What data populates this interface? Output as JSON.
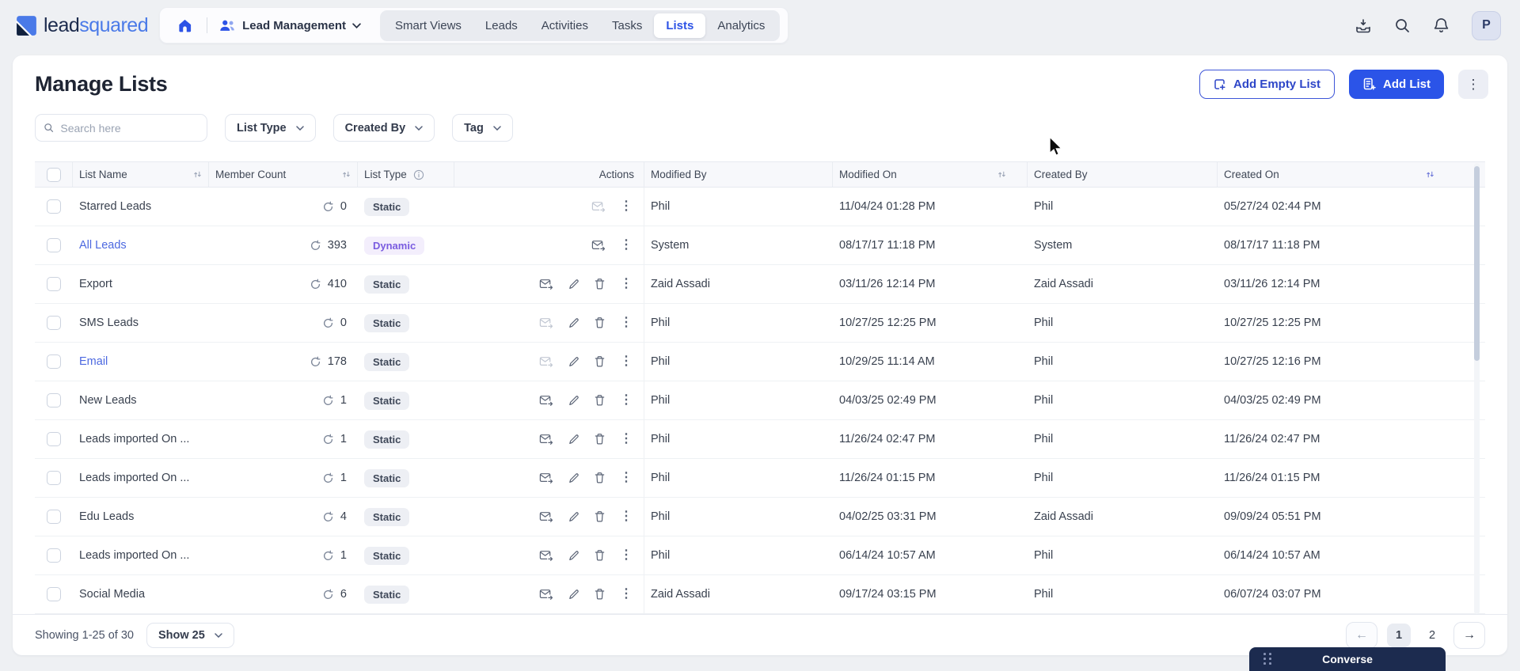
{
  "brand": {
    "name_dark": "lead",
    "name_blue": "squared"
  },
  "topnav": {
    "workspace_label": "Lead Management",
    "tabs": [
      {
        "label": "Smart Views",
        "active": false
      },
      {
        "label": "Leads",
        "active": false
      },
      {
        "label": "Activities",
        "active": false
      },
      {
        "label": "Tasks",
        "active": false
      },
      {
        "label": "Lists",
        "active": true
      },
      {
        "label": "Analytics",
        "active": false
      }
    ],
    "avatar_initial": "P"
  },
  "page": {
    "title": "Manage Lists",
    "add_empty_list_label": "Add Empty List",
    "add_list_label": "Add List"
  },
  "filters": {
    "search_placeholder": "Search here",
    "list_type_label": "List Type",
    "created_by_label": "Created By",
    "tag_label": "Tag"
  },
  "table": {
    "columns": [
      "List Name",
      "Member Count",
      "List Type",
      "Actions",
      "Modified By",
      "Modified On",
      "Created By",
      "Created On"
    ],
    "rows": [
      {
        "name": "Starred Leads",
        "is_link": false,
        "member_count": "0",
        "list_type": "Static",
        "actions": "minimal",
        "email_disabled": true,
        "modified_by": "Phil",
        "modified_on": "11/04/24 01:28 PM",
        "created_by": "Phil",
        "created_on": "05/27/24 02:44 PM"
      },
      {
        "name": "All Leads",
        "is_link": true,
        "member_count": "393",
        "list_type": "Dynamic",
        "actions": "minimal",
        "email_disabled": false,
        "modified_by": "System",
        "modified_on": "08/17/17 11:18 PM",
        "created_by": "System",
        "created_on": "08/17/17 11:18 PM"
      },
      {
        "name": "Export",
        "is_link": false,
        "member_count": "410",
        "list_type": "Static",
        "actions": "full",
        "email_disabled": false,
        "modified_by": "Zaid Assadi",
        "modified_on": "03/11/26 12:14 PM",
        "created_by": "Zaid Assadi",
        "created_on": "03/11/26 12:14 PM"
      },
      {
        "name": "SMS Leads",
        "is_link": false,
        "member_count": "0",
        "list_type": "Static",
        "actions": "full",
        "email_disabled": true,
        "modified_by": "Phil",
        "modified_on": "10/27/25 12:25 PM",
        "created_by": "Phil",
        "created_on": "10/27/25 12:25 PM"
      },
      {
        "name": "Email",
        "is_link": true,
        "member_count": "178",
        "list_type": "Static",
        "actions": "full",
        "email_disabled": true,
        "modified_by": "Phil",
        "modified_on": "10/29/25 11:14 AM",
        "created_by": "Phil",
        "created_on": "10/27/25 12:16 PM"
      },
      {
        "name": "New Leads",
        "is_link": false,
        "member_count": "1",
        "list_type": "Static",
        "actions": "full",
        "email_disabled": false,
        "modified_by": "Phil",
        "modified_on": "04/03/25 02:49 PM",
        "created_by": "Phil",
        "created_on": "04/03/25 02:49 PM"
      },
      {
        "name": "Leads imported On ...",
        "is_link": false,
        "member_count": "1",
        "list_type": "Static",
        "actions": "full",
        "email_disabled": false,
        "modified_by": "Phil",
        "modified_on": "11/26/24 02:47 PM",
        "created_by": "Phil",
        "created_on": "11/26/24 02:47 PM"
      },
      {
        "name": "Leads imported On ...",
        "is_link": false,
        "member_count": "1",
        "list_type": "Static",
        "actions": "full",
        "email_disabled": false,
        "modified_by": "Phil",
        "modified_on": "11/26/24 01:15 PM",
        "created_by": "Phil",
        "created_on": "11/26/24 01:15 PM"
      },
      {
        "name": "Edu Leads",
        "is_link": false,
        "member_count": "4",
        "list_type": "Static",
        "actions": "full",
        "email_disabled": false,
        "modified_by": "Phil",
        "modified_on": "04/02/25 03:31 PM",
        "created_by": "Zaid Assadi",
        "created_on": "09/09/24 05:51 PM"
      },
      {
        "name": "Leads imported On ...",
        "is_link": false,
        "member_count": "1",
        "list_type": "Static",
        "actions": "full",
        "email_disabled": false,
        "modified_by": "Phil",
        "modified_on": "06/14/24 10:57 AM",
        "created_by": "Phil",
        "created_on": "06/14/24 10:57 AM"
      },
      {
        "name": "Social Media",
        "is_link": false,
        "member_count": "6",
        "list_type": "Static",
        "actions": "full",
        "email_disabled": false,
        "modified_by": "Zaid Assadi",
        "modified_on": "09/17/24 03:15 PM",
        "created_by": "Phil",
        "created_on": "06/07/24 03:07 PM"
      }
    ]
  },
  "footer": {
    "showing_text": "Showing 1-25 of 30",
    "show_label": "Show 25",
    "pages": [
      "1",
      "2"
    ],
    "active_page": "1"
  },
  "converse": {
    "label": "Converse"
  },
  "colors": {
    "accent_blue": "#2b54e8",
    "link_blue": "#4c68e0",
    "static_badge_bg": "#edeff4",
    "static_badge_text": "#3f4859",
    "dynamic_badge_bg": "#f3eefc",
    "dynamic_badge_text": "#7a5ce0",
    "converse_bg": "#1c2b4f",
    "topbar_bg": "#eef0f3"
  }
}
